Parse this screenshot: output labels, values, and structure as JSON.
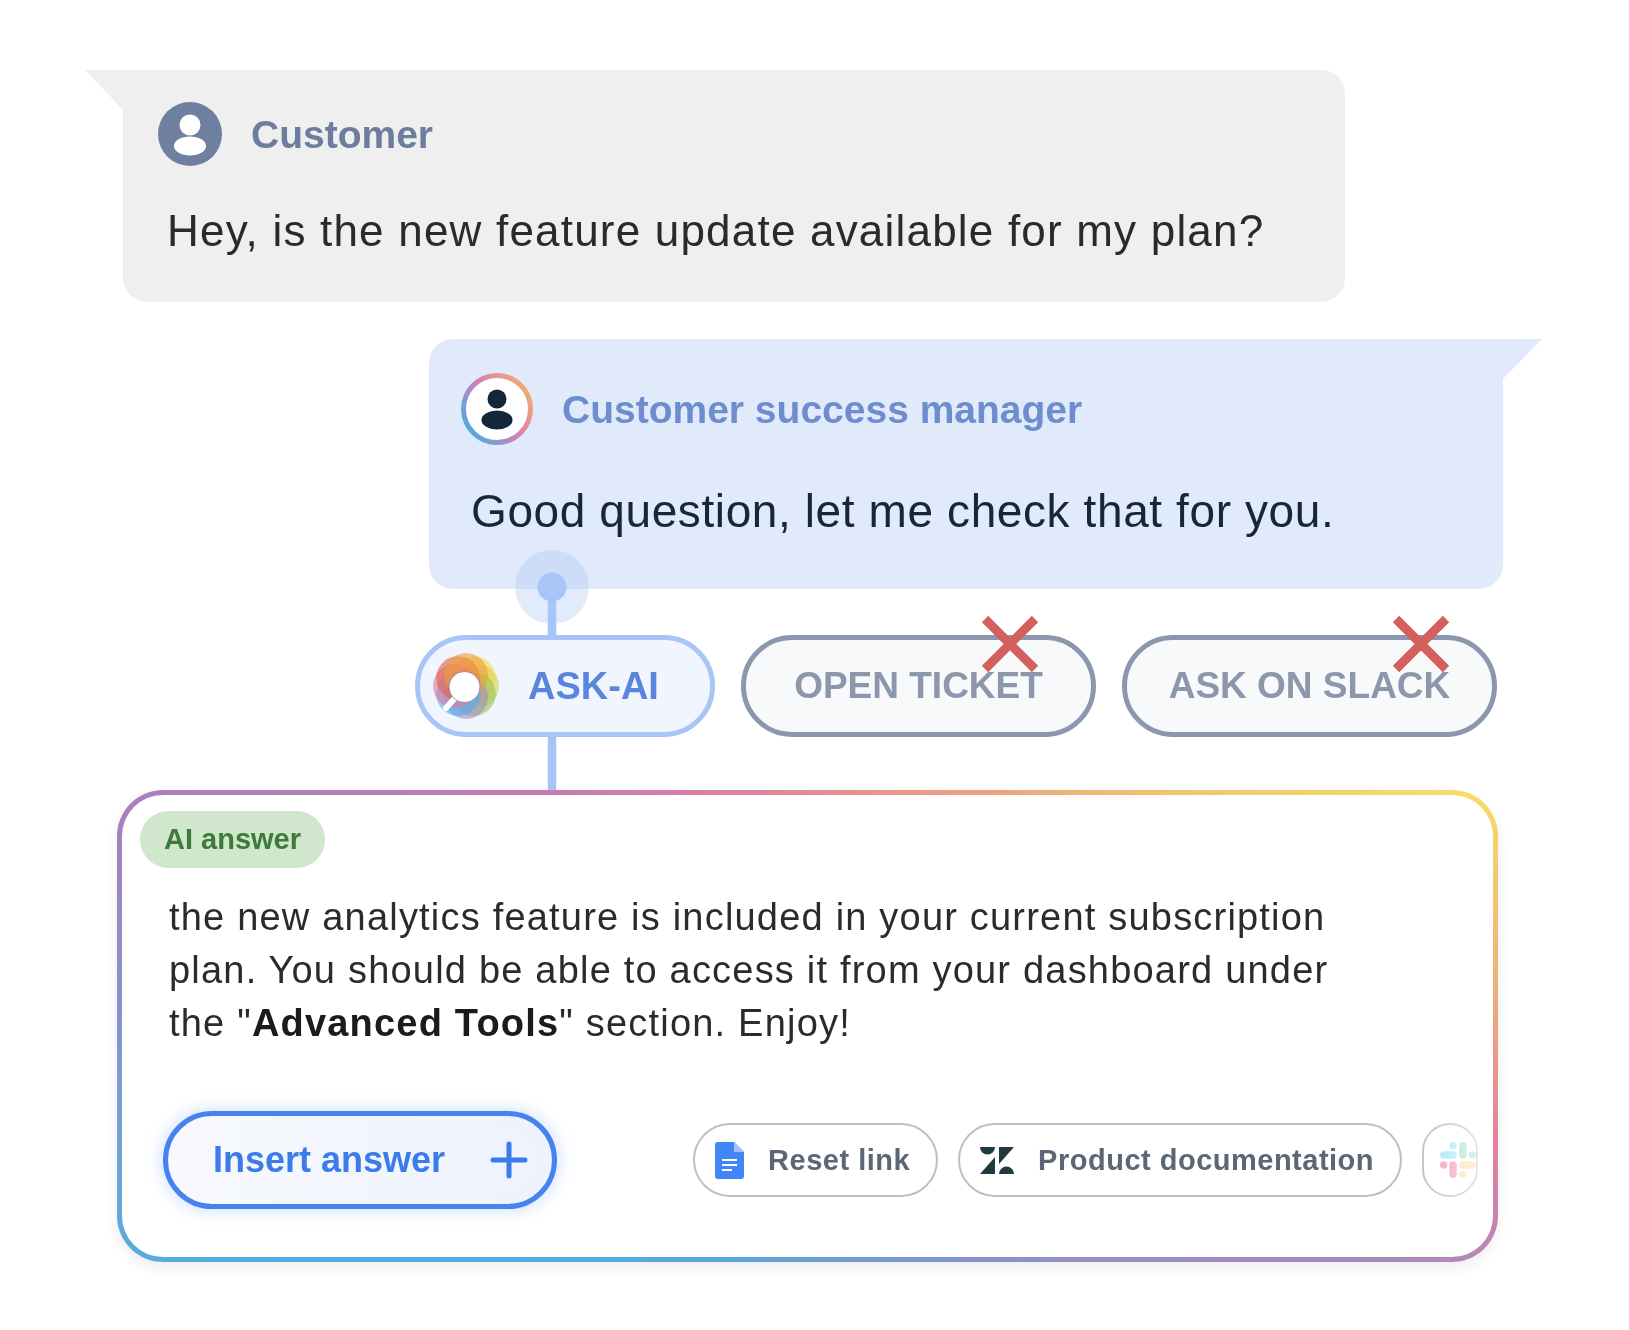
{
  "customer_message": {
    "author": "Customer",
    "text": "Hey, is the new feature update available for my plan?"
  },
  "agent_message": {
    "author": "Customer success manager",
    "text": "Good question, let me check that for you."
  },
  "actions": [
    {
      "kind": "ai",
      "label": "ASK-AI",
      "selected": true,
      "crossed_out": false
    },
    {
      "kind": "plain",
      "label": "OPEN TICKET",
      "selected": false,
      "crossed_out": true
    },
    {
      "kind": "plain",
      "label": "ASK ON SLACK",
      "selected": false,
      "crossed_out": true
    }
  ],
  "ai_answer": {
    "badge": "AI answer",
    "text": "the new analytics feature is included in your current subscription plan. You should be able to access it from your dashboard under the \"**Advanced Tools**\" section. Enjoy!",
    "insert_button": "Insert answer",
    "sources": [
      {
        "kind": "document",
        "label": "Reset link"
      },
      {
        "kind": "zshape",
        "label": "Product documentation"
      },
      {
        "kind": "hash"
      }
    ]
  }
}
